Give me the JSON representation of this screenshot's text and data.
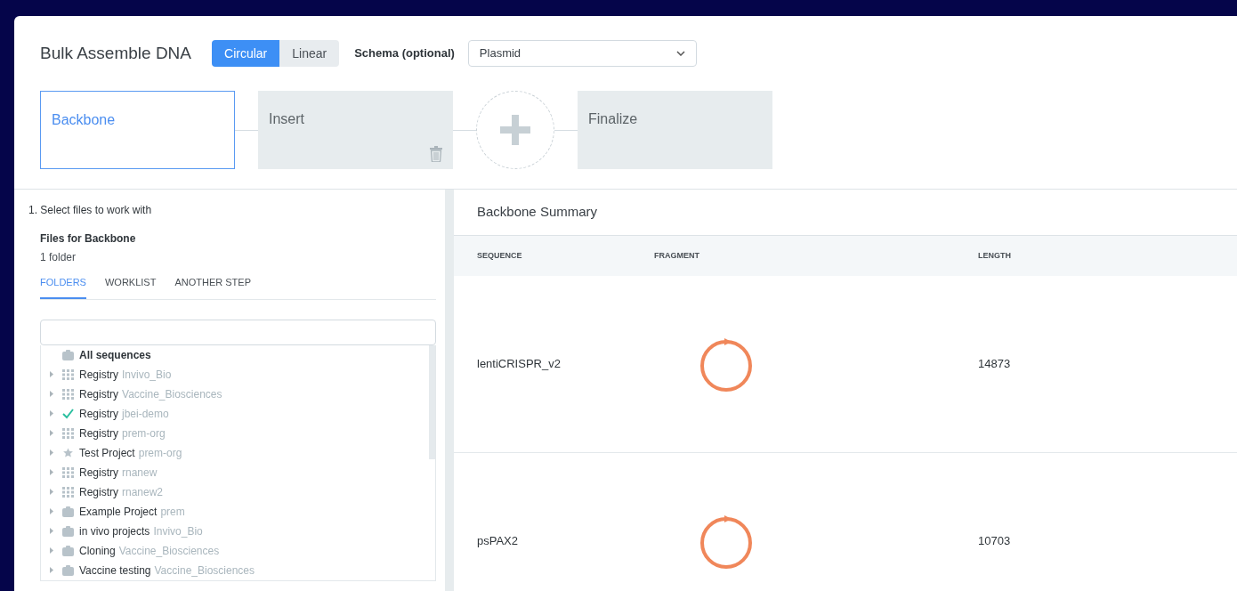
{
  "title": "Bulk Assemble DNA",
  "topology": [
    {
      "label": "Circular",
      "selected": true
    },
    {
      "label": "Linear",
      "selected": false
    }
  ],
  "schema": {
    "label": "Schema (optional)",
    "value": "Plasmid"
  },
  "steps": [
    {
      "kind": "step",
      "label": "Backbone",
      "selected": true,
      "deletable": false
    },
    {
      "kind": "step",
      "label": "Insert",
      "selected": false,
      "deletable": true
    },
    {
      "kind": "add"
    },
    {
      "kind": "step",
      "label": "Finalize",
      "selected": false,
      "deletable": false
    }
  ],
  "left": {
    "instruction": "1. Select files to work with",
    "heading": "Files for Backbone",
    "count": "1 folder",
    "tabs": [
      {
        "label": "FOLDERS",
        "selected": true
      },
      {
        "label": "WORKLIST",
        "selected": false
      },
      {
        "label": "ANOTHER STEP",
        "selected": false
      }
    ],
    "tree": [
      {
        "kind": "root",
        "name": "All sequences"
      },
      {
        "kind": "registry",
        "name": "Registry",
        "owner": "Invivo_Bio"
      },
      {
        "kind": "registry",
        "name": "Registry",
        "owner": "Vaccine_Biosciences"
      },
      {
        "kind": "checked",
        "name": "Registry",
        "owner": "jbei-demo"
      },
      {
        "kind": "registry",
        "name": "Registry",
        "owner": "prem-org"
      },
      {
        "kind": "starred",
        "name": "Test Project",
        "owner": "prem-org"
      },
      {
        "kind": "registry",
        "name": "Registry",
        "owner": "rnanew"
      },
      {
        "kind": "registry",
        "name": "Registry",
        "owner": "rnanew2"
      },
      {
        "kind": "project",
        "name": "Example Project",
        "owner": "prem"
      },
      {
        "kind": "project",
        "name": "in vivo projects",
        "owner": "Invivo_Bio"
      },
      {
        "kind": "project",
        "name": "Cloning",
        "owner": "Vaccine_Biosciences"
      },
      {
        "kind": "project",
        "name": "Vaccine testing",
        "owner": "Vaccine_Biosciences"
      }
    ]
  },
  "summary": {
    "title": "Backbone Summary",
    "columns": [
      "SEQUENCE",
      "FRAGMENT",
      "LENGTH"
    ],
    "rows": [
      {
        "kind": "circular",
        "sequence": "lentiCRISPR_v2",
        "length": "14873"
      },
      {
        "kind": "circular",
        "sequence": "psPAX2",
        "length": "10703"
      }
    ]
  }
}
